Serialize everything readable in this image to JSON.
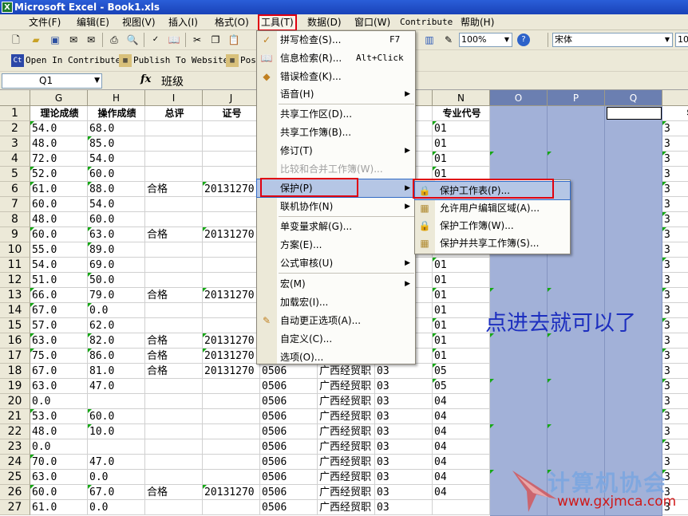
{
  "window": {
    "title": "Microsoft Excel - Book1.xls",
    "app_icon": "excel-icon"
  },
  "menubar": {
    "items": [
      "文件(F)",
      "编辑(E)",
      "视图(V)",
      "插入(I)",
      "格式(O)",
      "工具(T)",
      "数据(D)",
      "窗口(W)",
      "Contribute",
      "帮助(H)"
    ],
    "active": "工具(T)"
  },
  "toolbar": {
    "zoom": "100%",
    "font": "宋体",
    "font_size": "10"
  },
  "contribute_toolbar": {
    "open": "Open In Contribute",
    "publish": "Publish To Website",
    "post": "Pos"
  },
  "formula_bar": {
    "name_box": "Q1",
    "fx": "fx",
    "content": "班级"
  },
  "columns": [
    "G",
    "H",
    "I",
    "J",
    "K",
    "L",
    "M",
    "N",
    "O",
    "P",
    "Q",
    "R"
  ],
  "header_row": {
    "G": "理论成绩",
    "H": "操作成绩",
    "I": "总评",
    "J": "证号",
    "M": "号",
    "N": "专业代号",
    "R": "学"
  },
  "rows": [
    {
      "n": "1"
    },
    {
      "n": "2",
      "G": "54.0",
      "H": "68.0",
      "N": "01",
      "R": "3"
    },
    {
      "n": "3",
      "G": "48.0",
      "H": "85.0",
      "N": "01",
      "R": "3"
    },
    {
      "n": "4",
      "G": "72.0",
      "H": "54.0",
      "N": "01",
      "R": "3"
    },
    {
      "n": "5",
      "G": "52.0",
      "H": "60.0",
      "N": "01",
      "R": "3"
    },
    {
      "n": "6",
      "G": "61.0",
      "H": "88.0",
      "I": "合格",
      "J": "20131270",
      "R": "3"
    },
    {
      "n": "7",
      "G": "60.0",
      "H": "54.0",
      "R": "3"
    },
    {
      "n": "8",
      "G": "48.0",
      "H": "60.0",
      "R": "3"
    },
    {
      "n": "9",
      "G": "60.0",
      "H": "63.0",
      "I": "合格",
      "J": "20131270",
      "R": "3"
    },
    {
      "n": "10",
      "G": "55.0",
      "H": "89.0",
      "R": "3"
    },
    {
      "n": "11",
      "G": "54.0",
      "H": "69.0",
      "N": "01",
      "R": "3"
    },
    {
      "n": "12",
      "G": "51.0",
      "H": "50.0",
      "N": "01",
      "R": "3"
    },
    {
      "n": "13",
      "G": "66.0",
      "H": "79.0",
      "I": "合格",
      "J": "20131270",
      "N": "01",
      "R": "3"
    },
    {
      "n": "14",
      "G": "67.0",
      "H": "0.0",
      "N": "01",
      "R": "3"
    },
    {
      "n": "15",
      "G": "57.0",
      "H": "62.0",
      "N": "01",
      "R": "3"
    },
    {
      "n": "16",
      "G": "63.0",
      "H": "82.0",
      "I": "合格",
      "J": "20131270",
      "N": "01",
      "R": "3"
    },
    {
      "n": "17",
      "G": "75.0",
      "H": "86.0",
      "I": "合格",
      "J": "20131270",
      "N": "01",
      "R": "3"
    },
    {
      "n": "18",
      "G": "67.0",
      "H": "81.0",
      "I": "合格",
      "J": "20131270",
      "K": "0506",
      "L": "广西经贸职",
      "M": "03",
      "N": "05",
      "R": "3"
    },
    {
      "n": "19",
      "G": "63.0",
      "H": "47.0",
      "K": "0506",
      "L": "广西经贸职",
      "M": "03",
      "N": "05",
      "R": "3"
    },
    {
      "n": "20",
      "G": "0.0",
      "K": "0506",
      "L": "广西经贸职",
      "M": "03",
      "N": "04",
      "R": "3"
    },
    {
      "n": "21",
      "G": "53.0",
      "H": "60.0",
      "K": "0506",
      "L": "广西经贸职",
      "M": "03",
      "N": "04",
      "R": "3"
    },
    {
      "n": "22",
      "G": "48.0",
      "H": "10.0",
      "K": "0506",
      "L": "广西经贸职",
      "M": "03",
      "N": "04",
      "R": "3"
    },
    {
      "n": "23",
      "G": "0.0",
      "K": "0506",
      "L": "广西经贸职",
      "M": "03",
      "N": "04",
      "R": "3"
    },
    {
      "n": "24",
      "G": "70.0",
      "H": "47.0",
      "K": "0506",
      "L": "广西经贸职",
      "M": "03",
      "N": "04",
      "R": "3"
    },
    {
      "n": "25",
      "G": "63.0",
      "H": "0.0",
      "K": "0506",
      "L": "广西经贸职",
      "M": "03",
      "N": "04",
      "R": "3"
    },
    {
      "n": "26",
      "G": "60.0",
      "H": "67.0",
      "I": "合格",
      "J": "20131270",
      "K": "0506",
      "L": "广西经贸职",
      "M": "03",
      "N": "04",
      "R": "3"
    },
    {
      "n": "27",
      "G": "61.0",
      "H": "0.0",
      "K": "0506",
      "L": "广西经贸职",
      "M": "03",
      "R": "3"
    }
  ],
  "tools_menu": {
    "items": [
      {
        "label": "拼写检查(S)...",
        "shortcut": "F7",
        "icon": "spellcheck-icon"
      },
      {
        "label": "信息检索(R)...",
        "shortcut": "Alt+Click",
        "icon": "research-icon"
      },
      {
        "label": "错误检查(K)...",
        "icon": "error-check-icon"
      },
      {
        "label": "语音(H)",
        "submenu": true
      },
      {
        "label": "共享工作区(D)..."
      },
      {
        "label": "共享工作簿(B)..."
      },
      {
        "label": "修订(T)",
        "submenu": true
      },
      {
        "label": "比较和合并工作簿(W)...",
        "disabled": true
      },
      {
        "label": "保护(P)",
        "submenu": true,
        "highlighted": true
      },
      {
        "label": "联机协作(N)",
        "submenu": true
      },
      {
        "label": "单变量求解(G)..."
      },
      {
        "label": "方案(E)..."
      },
      {
        "label": "公式审核(U)",
        "submenu": true
      },
      {
        "label": "宏(M)",
        "submenu": true
      },
      {
        "label": "加载宏(I)..."
      },
      {
        "label": "自动更正选项(A)...",
        "icon": "autocorrect-icon"
      },
      {
        "label": "自定义(C)..."
      },
      {
        "label": "选项(O)..."
      }
    ]
  },
  "protect_submenu": {
    "items": [
      {
        "label": "保护工作表(P)...",
        "icon": "protect-sheet-icon",
        "highlighted": true
      },
      {
        "label": "允许用户编辑区域(A)...",
        "icon": "allow-edit-icon"
      },
      {
        "label": "保护工作簿(W)...",
        "icon": "protect-workbook-icon"
      },
      {
        "label": "保护并共享工作簿(S)...",
        "icon": "protect-share-icon"
      }
    ]
  },
  "annotation": "点进去就可以了",
  "watermark": {
    "title": "计算机协会",
    "url": "www.gxjmca.com"
  },
  "colors": {
    "selection": "#a2b1d8",
    "highlight_box": "#e00010",
    "annotation": "#1d2fbf",
    "menu_hover": "#b5c6e5"
  }
}
